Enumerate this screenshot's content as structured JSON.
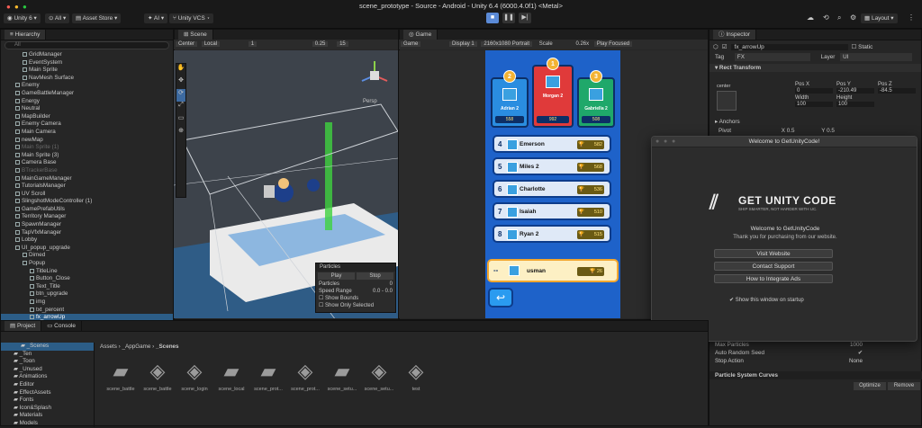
{
  "window_title": "scene_prototype - Source - Android - Unity 6.4 (6000.4.0f1) <Metal>",
  "toolbar": {
    "account": "Unity 6",
    "filter_all": "All",
    "asset_store": "Asset Store",
    "ai": "AI",
    "vcs": "Unity VCS",
    "layout": "Layout"
  },
  "hierarchy": {
    "tab": "Hierarchy",
    "search_placeholder": "All",
    "items": [
      {
        "label": "GridManager",
        "indent": 2,
        "state": ""
      },
      {
        "label": "EventSystem",
        "indent": 2,
        "state": ""
      },
      {
        "label": "Main Sprite",
        "indent": 2,
        "state": ""
      },
      {
        "label": "NavMesh Surface",
        "indent": 2,
        "state": ""
      },
      {
        "label": "Enemy",
        "indent": 1,
        "state": ""
      },
      {
        "label": "GameBattleManager",
        "indent": 1,
        "state": ""
      },
      {
        "label": "Energy",
        "indent": 1,
        "state": ""
      },
      {
        "label": "Neutral",
        "indent": 1,
        "state": ""
      },
      {
        "label": "MapBuilder",
        "indent": 1,
        "state": ""
      },
      {
        "label": "Enemy Camera",
        "indent": 1,
        "state": ""
      },
      {
        "label": "Main Camera",
        "indent": 1,
        "state": ""
      },
      {
        "label": "newMap",
        "indent": 1,
        "state": ""
      },
      {
        "label": "Main Sprite (1)",
        "indent": 1,
        "state": "dim"
      },
      {
        "label": "Main Sprite (3)",
        "indent": 1,
        "state": ""
      },
      {
        "label": "Camera Base",
        "indent": 1,
        "state": ""
      },
      {
        "label": "BTrackerBase",
        "indent": 1,
        "state": "dim"
      },
      {
        "label": "MainGameManager",
        "indent": 1,
        "state": ""
      },
      {
        "label": "TutorialsManager",
        "indent": 1,
        "state": ""
      },
      {
        "label": "UV Scroll",
        "indent": 1,
        "state": ""
      },
      {
        "label": "SlingshotModeController (1)",
        "indent": 1,
        "state": ""
      },
      {
        "label": "GamePrefabUtils",
        "indent": 1,
        "state": ""
      },
      {
        "label": "Territory Manager",
        "indent": 1,
        "state": ""
      },
      {
        "label": "SpawnManager",
        "indent": 1,
        "state": ""
      },
      {
        "label": "TapVfxManager",
        "indent": 1,
        "state": ""
      },
      {
        "label": "Lobby",
        "indent": 1,
        "state": ""
      },
      {
        "label": "UI_popup_upgrade",
        "indent": 1,
        "state": ""
      },
      {
        "label": "Dimed",
        "indent": 2,
        "state": ""
      },
      {
        "label": "Popup",
        "indent": 2,
        "state": ""
      },
      {
        "label": "TitleLine",
        "indent": 3,
        "state": ""
      },
      {
        "label": "Button_Close",
        "indent": 3,
        "state": ""
      },
      {
        "label": "Text_Title",
        "indent": 3,
        "state": ""
      },
      {
        "label": "btn_upgrade",
        "indent": 3,
        "state": ""
      },
      {
        "label": "img",
        "indent": 3,
        "state": ""
      },
      {
        "label": "txt_percent",
        "indent": 3,
        "state": ""
      },
      {
        "label": "fx_arrowUp",
        "indent": 3,
        "state": "sel"
      }
    ]
  },
  "scene": {
    "tab": "Scene",
    "center": "Center",
    "local": "Local",
    "num1": "1",
    "snap": "0.25",
    "grid": "15",
    "persp": "Persp",
    "overlay": {
      "title": "Particles",
      "play": "Play",
      "stop": "Stop",
      "particles_label": "Particles",
      "particles_value": "0",
      "speed_label": "Speed Range",
      "speed_value": "0.0 - 0.0",
      "show_bounds": "Show Bounds",
      "show_only_selected": "Show Only Selected"
    }
  },
  "game": {
    "tab": "Game",
    "mode": "Game",
    "display": "Display 1",
    "resolution": "2160x1080 Portrait",
    "scale_label": "Scale",
    "scale_value": "0.26x",
    "play_focused": "Play Focused",
    "podium": [
      {
        "rank": "2",
        "name": "Adrian 2",
        "score": "558",
        "color": "#2a8de0"
      },
      {
        "rank": "1",
        "name": "Morgan 2",
        "score": "992",
        "color": "#e03a3a"
      },
      {
        "rank": "3",
        "name": "Gabriella 2",
        "score": "508",
        "color": "#1fa86a"
      }
    ],
    "rows": [
      {
        "rank": "4",
        "name": "Emerson",
        "score": "582"
      },
      {
        "rank": "5",
        "name": "Miles 2",
        "score": "568"
      },
      {
        "rank": "6",
        "name": "Charlotte",
        "score": "536"
      },
      {
        "rank": "7",
        "name": "Isaiah",
        "score": "510"
      },
      {
        "rank": "8",
        "name": "Ryan 2",
        "score": "515"
      }
    ],
    "me": {
      "rank": "--",
      "name": "usman",
      "score": "26"
    }
  },
  "inspector": {
    "tab": "Inspector",
    "object_name": "fx_arrowUp",
    "static": "Static",
    "tag_label": "Tag",
    "tag_value": "FX",
    "layer_label": "Layer",
    "layer_value": "UI",
    "rect_transform": "Rect Transform",
    "anchor_label": "center",
    "pos_x_label": "Pos X",
    "pos_y_label": "Pos Y",
    "pos_z_label": "Pos Z",
    "pos_x": "0",
    "pos_y": "-210.49",
    "pos_z": "-84.5",
    "width_label": "Width",
    "height_label": "Height",
    "width": "100",
    "height": "100",
    "anchors": "Anchors",
    "pivot": "Pivot",
    "pivot_x": "0.5",
    "pivot_y": "0.5",
    "max_particles_label": "Max Particles",
    "max_particles": "1000",
    "auto_random_seed": "Auto Random Seed",
    "stop_action_label": "Stop Action",
    "stop_action": "None",
    "curves": "Particle System Curves",
    "optimize": "Optimize",
    "remove": "Remove"
  },
  "dialog": {
    "title": "Welcome to GetUnityCode!",
    "logo": "GET UNITY CODE",
    "tagline": "SHIP SMARTER, NOT HARDER WITH UC.",
    "welcome": "Welcome to GetUnityCode",
    "thanks": "Thank you for purchasing from our website.",
    "btn_visit": "Visit Website",
    "btn_support": "Contact Support",
    "btn_ads": "How to Integrate Ads",
    "checkbox": "Show this window on startup"
  },
  "project": {
    "tab_project": "Project",
    "tab_console": "Console",
    "folders": [
      "_Scenes",
      "_Ten",
      "_Toon",
      "_Unused",
      "Animations",
      "Editor",
      "EffectAssets",
      "Fonts",
      "Icon&Splash",
      "Materials",
      "Models"
    ],
    "breadcrumb": [
      "Assets",
      "_AppGame",
      "_Scenes"
    ],
    "assets": [
      {
        "name": "scene_battle",
        "kind": "folder"
      },
      {
        "name": "scene_battle",
        "kind": "unity"
      },
      {
        "name": "scene_login",
        "kind": "unity"
      },
      {
        "name": "scene_local",
        "kind": "folder"
      },
      {
        "name": "scene_prot...",
        "kind": "folder"
      },
      {
        "name": "scene_prot...",
        "kind": "unity"
      },
      {
        "name": "scene_setu...",
        "kind": "folder"
      },
      {
        "name": "scene_setu...",
        "kind": "unity"
      },
      {
        "name": "test",
        "kind": "unity"
      }
    ]
  }
}
